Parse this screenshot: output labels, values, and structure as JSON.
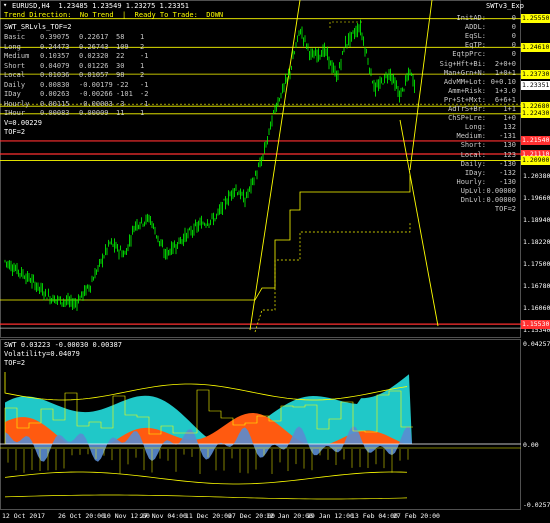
{
  "header": {
    "symbol_line": "EURUSD,H4  1.23485 1.23549 1.23275 1.23351",
    "trend_line": "Trend Direction:  No Trend  |  Ready To Trade:  DOWN",
    "indicator_name": "SWTv3_Exp"
  },
  "left_panel": {
    "title": "SWT_SRLvls_TOF=2",
    "rows": [
      {
        "name": "Basic",
        "a": "0.39075",
        "b": "0.22617",
        "c": "58",
        "d": "1"
      },
      {
        "name": "Long",
        "a": "0.24473",
        "b": "0.26743",
        "c": "109",
        "d": "2"
      },
      {
        "name": "Medium",
        "a": "0.10357",
        "b": "0.02320",
        "c": "22",
        "d": "-1"
      },
      {
        "name": "Short",
        "a": "0.04079",
        "b": "0.01226",
        "c": "30",
        "d": "1"
      },
      {
        "name": "Local",
        "a": "0.01036",
        "b": "0.01057",
        "c": "98",
        "d": "2"
      },
      {
        "name": "Daily",
        "a": "0.00830",
        "b": "-0.00179",
        "c": "-22",
        "d": "-1"
      },
      {
        "name": "IDay",
        "a": "0.00263",
        "b": "-0.00266",
        "c": "-101",
        "d": "-2"
      },
      {
        "name": "Hourly",
        "a": "0.00115",
        "b": "-0.00003",
        "c": "-3",
        "d": "-1"
      },
      {
        "name": "IHour",
        "a": "0.00083",
        "b": "0.00009",
        "c": "11",
        "d": "1"
      }
    ],
    "v_line": "V=0.00229",
    "tof_line": "TOF=2"
  },
  "right_panel": {
    "rows": [
      {
        "label": "InitAD:",
        "value": "0"
      },
      {
        "label": "ADDL:",
        "value": "0"
      },
      {
        "label": "EqSL:",
        "value": "0"
      },
      {
        "label": "EqTP:",
        "value": "0"
      },
      {
        "label": "EqtpPrc:",
        "value": "0"
      },
      {
        "label": "Sig+Hft+Bi:",
        "value": "2+0+0"
      },
      {
        "label": "Man+Grn+N:",
        "value": "1+0+1"
      },
      {
        "label": "AdvMM+Lot:",
        "value": "0+0.10"
      },
      {
        "label": "Amm+Risk:",
        "value": "1+3.0"
      },
      {
        "label": "Pr+St+Mxt:",
        "value": "6+6+1"
      },
      {
        "label": "AdTrS+Br:",
        "value": "1+1"
      },
      {
        "label": "ChSP+Lre:",
        "value": "1+0"
      },
      {
        "label": "Long:",
        "value": "132"
      },
      {
        "label": "Medium:",
        "value": "-131"
      },
      {
        "label": "Short:",
        "value": "130"
      },
      {
        "label": "Local:",
        "value": "123"
      },
      {
        "label": "Daily:",
        "value": "-130"
      },
      {
        "label": "IDay:",
        "value": "-132"
      },
      {
        "label": "Hourly:",
        "value": "-130"
      },
      {
        "label": "UpLvl:",
        "value": "0.00000"
      },
      {
        "label": "DnLvl:",
        "value": "0.00000"
      },
      {
        "label": "",
        "value": "TOF=2"
      }
    ]
  },
  "price_axis": {
    "labels": [
      "1.25550",
      "1.24610",
      "1.23730",
      "1.23351",
      "1.22680",
      "1.22430",
      "1.21540",
      "1.21110",
      "1.20900",
      "1.20380",
      "1.19660",
      "1.18940",
      "1.18220",
      "1.17500",
      "1.16780",
      "1.16060",
      "1.15530",
      "1.15340"
    ],
    "boxes": [
      {
        "text": "1.25550",
        "color": "#ffff00",
        "fg": "#000"
      },
      {
        "text": "1.24610",
        "color": "#ffff00",
        "fg": "#000"
      },
      {
        "text": "1.23730",
        "color": "#ffff00",
        "fg": "#000"
      },
      {
        "text": "1.23351",
        "color": "#ffffff",
        "fg": "#000"
      },
      {
        "text": "1.22680",
        "color": "#ffff00",
        "fg": "#000"
      },
      {
        "text": "1.22430",
        "color": "#ffff00",
        "fg": "#000"
      },
      {
        "text": "1.21540",
        "color": "#ff3030",
        "fg": "#fff"
      },
      {
        "text": "1.21110",
        "color": "#ff3030",
        "fg": "#fff"
      },
      {
        "text": "1.20900",
        "color": "#ffff00",
        "fg": "#000"
      },
      {
        "text": "1.15530",
        "color": "#ff3030",
        "fg": "#fff"
      }
    ]
  },
  "sub_window": {
    "title": "SWT 0.03223 -0.00030 0.00387",
    "volatility": "Volatility=0.04079",
    "tof": "TOF=2",
    "axis": [
      "0.04257",
      "0.00",
      "-0.02579"
    ]
  },
  "time_axis": [
    "12 Oct 2017",
    "26 Oct 20:00",
    "10 Nov 12:00",
    "27 Nov 04:00",
    "11 Dec 20:00",
    "27 Dec 20:00",
    "12 Jan 20:00",
    "29 Jan 12:00",
    "13 Feb 04:00",
    "27 Feb 20:00"
  ],
  "colors": {
    "candle": "#00ff00",
    "level_yellow": "#ffff00",
    "level_red": "#ff3030",
    "teal": "#20c8c8",
    "orange": "#ff5a10",
    "blue": "#5a8cd2"
  }
}
